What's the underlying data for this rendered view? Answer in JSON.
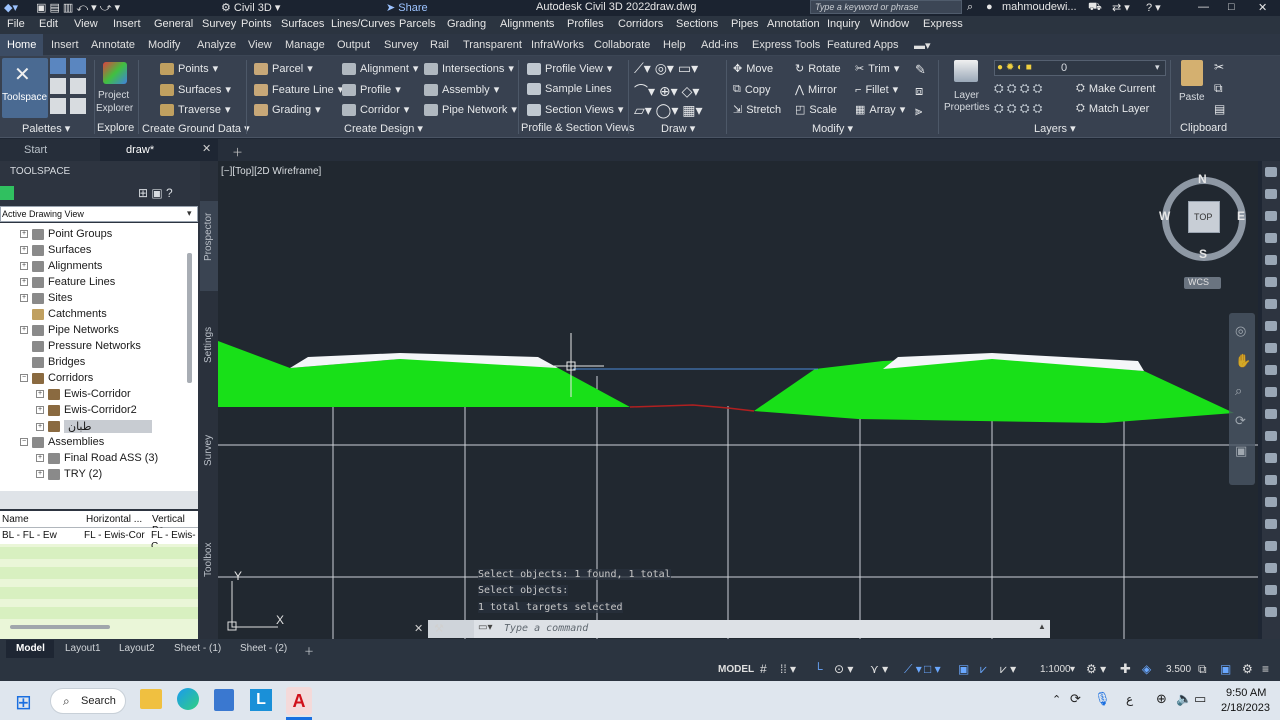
{
  "titlebar": {
    "workspace": "Civil 3D",
    "share": "Share",
    "app_title": "Autodesk Civil 3D 2022",
    "file_title": "draw.dwg",
    "search_placeholder": "Type a keyword or phrase",
    "user": "mahmoudewi..."
  },
  "menu": [
    "File",
    "Edit",
    "View",
    "Insert",
    "General",
    "Survey",
    "Points",
    "Surfaces",
    "Lines/Curves",
    "Parcels",
    "Grading",
    "Alignments",
    "Profiles",
    "Corridors",
    "Sections",
    "Pipes",
    "Annotation",
    "Inquiry",
    "Window",
    "Express"
  ],
  "ribbon_tabs": [
    "Home",
    "Insert",
    "Annotate",
    "Modify",
    "Analyze",
    "View",
    "Manage",
    "Output",
    "Survey",
    "Rail",
    "Transparent",
    "InfraWorks",
    "Collaborate",
    "Help",
    "Add-ins",
    "Express Tools",
    "Featured Apps"
  ],
  "ribbon": {
    "toolspace": "Toolspace",
    "project_explorer": [
      "Project",
      "Explorer"
    ],
    "points": "Points",
    "surfaces": "Surfaces",
    "traverse": "Traverse",
    "parcel": "Parcel",
    "feature_line": "Feature Line",
    "grading": "Grading",
    "alignment": "Alignment",
    "profile": "Profile",
    "corridor": "Corridor",
    "intersections": "Intersections",
    "assembly": "Assembly",
    "pipe_network": "Pipe Network",
    "profile_view": "Profile View",
    "sample_lines": "Sample Lines",
    "section_views": "Section Views",
    "move": "Move",
    "copy": "Copy",
    "stretch": "Stretch",
    "rotate": "Rotate",
    "mirror": "Mirror",
    "scale": "Scale",
    "trim": "Trim",
    "fillet": "Fillet",
    "array": "Array",
    "layer_properties": [
      "Layer",
      "Properties"
    ],
    "layer_value": "0",
    "make_current": "Make Current",
    "match_layer": "Match Layer",
    "paste": "Paste",
    "panels": {
      "palettes": "Palettes",
      "explore": "Explore",
      "create_ground_data": "Create Ground Data",
      "create_design": "Create Design",
      "profile_section_views": "Profile & Section Views",
      "draw": "Draw",
      "modify": "Modify",
      "layers": "Layers",
      "clipboard": "Clipboard"
    }
  },
  "doc_tabs": {
    "start": "Start",
    "draw": "draw*"
  },
  "toolspace": {
    "title": "TOOLSPACE",
    "view_select": "Active Drawing View",
    "tree": [
      "Point Groups",
      "Surfaces",
      "Alignments",
      "Feature Lines",
      "Sites",
      "Catchments",
      "Pipe Networks",
      "Pressure Networks",
      "Bridges",
      "Corridors",
      "Ewis-Corridor",
      "Ewis-Corridor2",
      "طبان",
      "Assemblies",
      "Final Road ASS (3)",
      "TRY (2)"
    ],
    "side_tabs": [
      "Prospector",
      "Settings",
      "Survey",
      "Toolbox"
    ],
    "table_headers": [
      "Name",
      "Horizontal ...",
      "Vertical Ba"
    ],
    "table_row": [
      "BL - FL - Ew",
      "FL - Ewis-Cor",
      "FL - Ewis-C"
    ]
  },
  "viewport": {
    "label": "[−][Top][2D Wireframe]",
    "compass": {
      "n": "N",
      "s": "S",
      "e": "E",
      "w": "W",
      "top": "TOP",
      "wcs": "WCS"
    },
    "ucs_y": "Y",
    "ucs_x": "X"
  },
  "command": {
    "history": [
      "Select objects: 1 found, 1 total",
      "Select objects:",
      "1 total targets selected"
    ],
    "placeholder": "Type a command"
  },
  "layouts": [
    "Model",
    "Layout1",
    "Layout2",
    "Sheet - (1)",
    "Sheet - (2)"
  ],
  "status": {
    "model": "MODEL",
    "scale": "1:1000",
    "value": "3.500"
  },
  "taskbar": {
    "search": "Search",
    "lang": "ع",
    "time": "9:50 AM",
    "date": "2/18/2023"
  },
  "colors": {
    "corridor": "#18e018",
    "viewport_bg": "#212830",
    "ribbon_bg": "#384150",
    "accent": "#3c4c64"
  }
}
